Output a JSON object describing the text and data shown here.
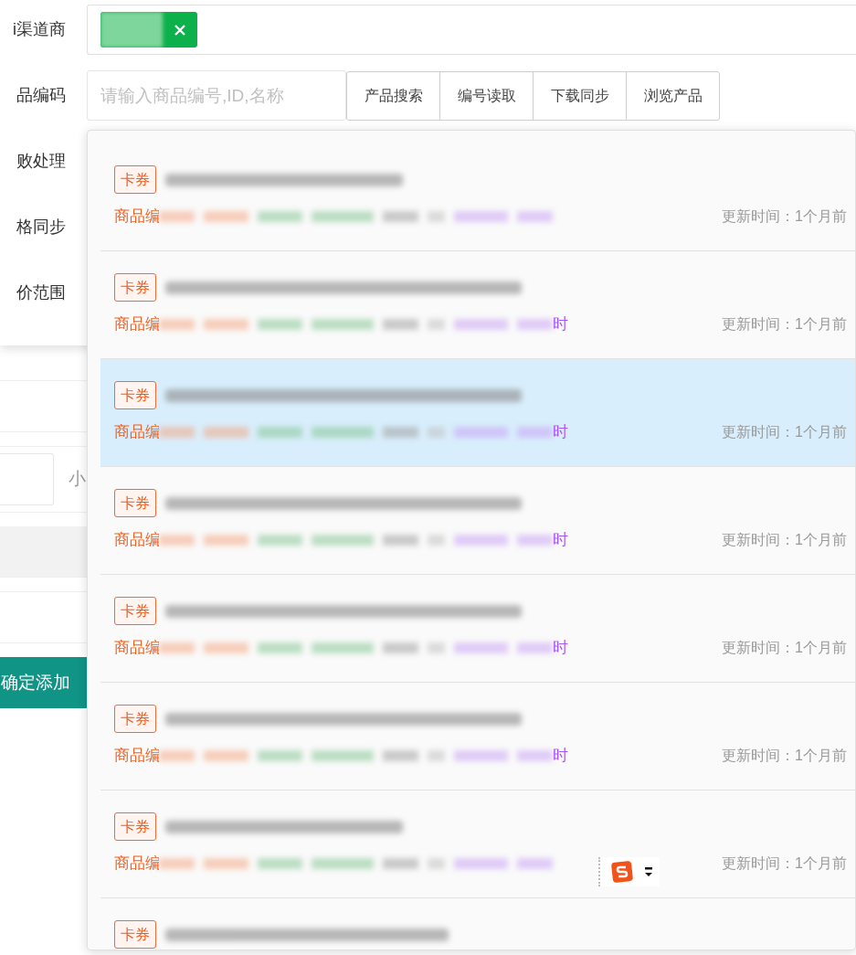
{
  "form_labels": [
    "i渠道商",
    "品编码",
    "败处理",
    "格同步",
    "价范围"
  ],
  "channel_field": {
    "tag_removable": true
  },
  "code_input": {
    "placeholder": "请输入商品编号,ID,名称"
  },
  "code_buttons": [
    "产品搜索",
    "编号读取",
    "下载同步",
    "浏览产品"
  ],
  "background_form": {
    "text": "小",
    "submit_button": "确定添加"
  },
  "results": [
    {
      "tag": "卡券",
      "code_label": "商品编",
      "updated": "更新时间：1个月前",
      "selected": false
    },
    {
      "tag": "卡券",
      "code_label": "商品编",
      "suffix": "时",
      "updated": "更新时间：1个月前",
      "selected": false
    },
    {
      "tag": "卡券",
      "code_label": "商品编",
      "suffix": "时",
      "updated": "更新时间：1个月前",
      "selected": true
    },
    {
      "tag": "卡券",
      "code_label": "商品编",
      "suffix": "时",
      "updated": "更新时间：1个月前",
      "selected": false
    },
    {
      "tag": "卡券",
      "code_label": "商品编",
      "suffix": "时",
      "updated": "更新时间：1个月前",
      "selected": false
    },
    {
      "tag": "卡券",
      "code_label": "商品编",
      "suffix": "时",
      "updated": "更新时间：1个月前",
      "selected": false
    },
    {
      "tag": "卡券",
      "code_label": "商品编",
      "updated": "更新时间：1个月前",
      "selected": false
    }
  ],
  "last_result": {
    "tag": "卡券"
  }
}
